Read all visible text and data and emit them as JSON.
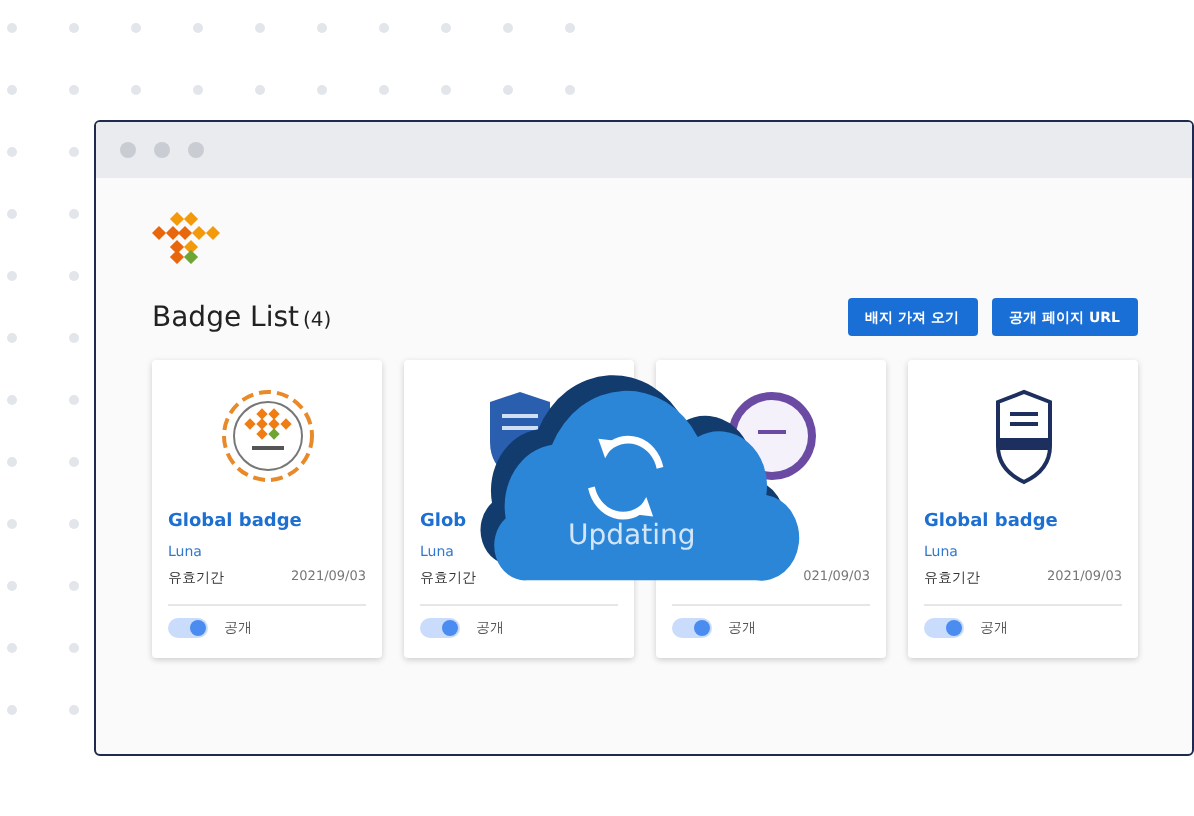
{
  "page": {
    "title": "Badge List",
    "count": "(4)"
  },
  "buttons": [
    {
      "label": "배지 가져 오기"
    },
    {
      "label": "공개 페이지 URL"
    }
  ],
  "badges": [
    {
      "kind": "emblem",
      "title": "Global badge",
      "owner": "Luna",
      "validity_label": "유효기간",
      "date": "2021/09/03",
      "public": {
        "on": true,
        "label": "공개"
      }
    },
    {
      "kind": "shield",
      "title": "Glob",
      "owner": "Luna",
      "validity_label": "유효기간",
      "public": {
        "on": true,
        "label": "공개"
      }
    },
    {
      "kind": "seal",
      "date": "021/09/03",
      "public": {
        "on": true,
        "label": "공개"
      }
    },
    {
      "kind": "open",
      "title": "Global badge",
      "owner": "Luna",
      "validity_label": "유효기간",
      "date": "2021/09/03",
      "public": {
        "on": true,
        "label": "공개"
      }
    }
  ],
  "overlay": {
    "label": "Updating"
  }
}
